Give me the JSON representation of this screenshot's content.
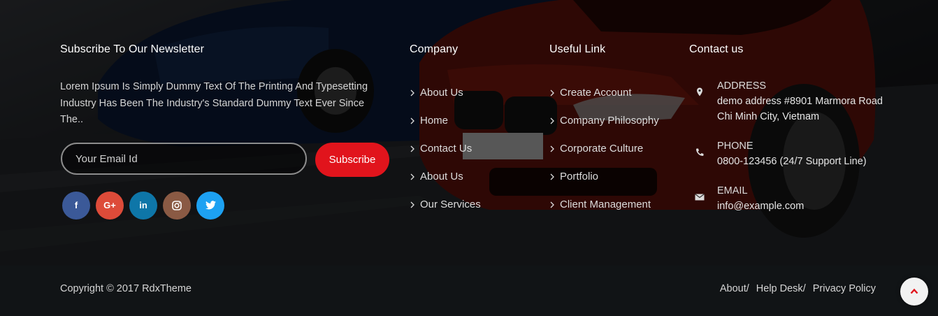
{
  "newsletter": {
    "title": "Subscribe To Our Newsletter",
    "description": "Lorem Ipsum Is Simply Dummy Text Of The Printing And Typesetting Industry Has Been The Industry's Standard Dummy Text Ever Since The..",
    "email_placeholder": "Your Email Id",
    "subscribe_label": "Subscribe"
  },
  "social": [
    {
      "name": "facebook",
      "icon": "facebook-icon",
      "color": "#3b5998",
      "glyph": "f"
    },
    {
      "name": "google-plus",
      "icon": "google-plus-icon",
      "color": "#dd4b39",
      "glyph": "G+"
    },
    {
      "name": "linkedin",
      "icon": "linkedin-icon",
      "color": "#0e76a8",
      "glyph": "in"
    },
    {
      "name": "instagram",
      "icon": "instagram-icon",
      "color": "#8a5a44"
    },
    {
      "name": "twitter",
      "icon": "twitter-icon",
      "color": "#1da1f2"
    }
  ],
  "company": {
    "title": "Company",
    "links": [
      "About Us",
      "Home",
      "Contact Us",
      "About Us",
      "Our Services"
    ]
  },
  "useful": {
    "title": "Useful Link",
    "links": [
      "Create Account",
      "Company Philosophy",
      "Corporate Culture",
      "Portfolio",
      "Client Management"
    ]
  },
  "contact": {
    "title": "Contact us",
    "address": {
      "label": "ADDRESS",
      "value": "demo address #8901 Marmora Road Chi Minh City, Vietnam",
      "icon": "map-marker-icon"
    },
    "phone": {
      "label": "PHONE",
      "value": "0800-123456 (24/7 Support Line)",
      "icon": "phone-icon"
    },
    "email": {
      "label": "EMAIL",
      "value": "info@example.com",
      "icon": "envelope-icon"
    }
  },
  "bottom": {
    "copyright": "Copyright © 2017 RdxTheme",
    "links": [
      "About",
      "Help Desk",
      "Privacy Policy"
    ],
    "separator": "/",
    "back_to_top_icon": "chevron-up-icon"
  },
  "colors": {
    "accent": "#e1141c",
    "bottom_bar": "#111416"
  }
}
